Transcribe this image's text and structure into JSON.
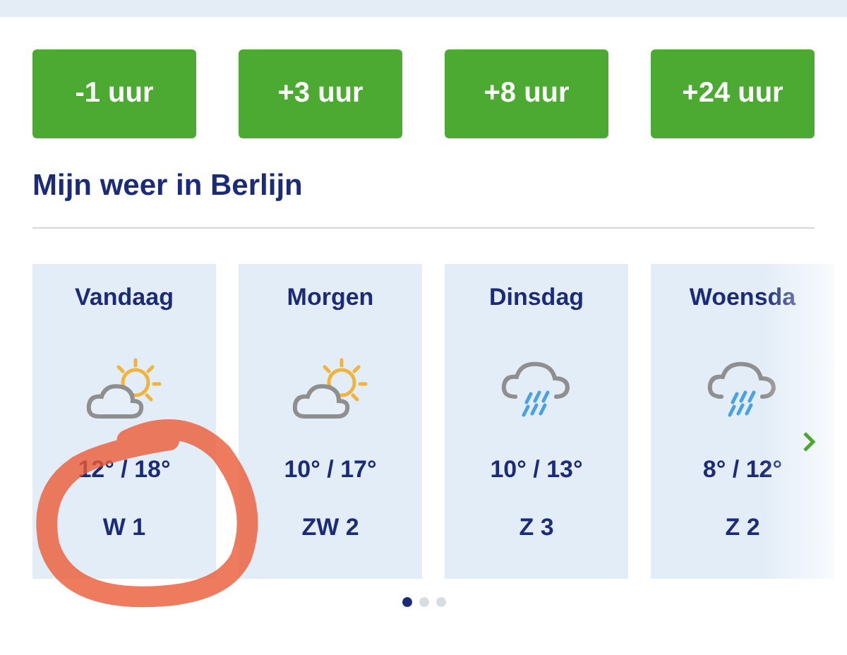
{
  "time_buttons": [
    "-1 uur",
    "+3 uur",
    "+8 uur",
    "+24 uur"
  ],
  "title": "Mijn weer in Berlijn",
  "days": [
    {
      "day": "Vandaag",
      "kind": "sun-cloud",
      "temps": "12° / 18°",
      "wind": "W 1"
    },
    {
      "day": "Morgen",
      "kind": "sun-cloud",
      "temps": "10° / 17°",
      "wind": "ZW 2"
    },
    {
      "day": "Dinsdag",
      "kind": "rain",
      "temps": "10° / 13°",
      "wind": "Z 3"
    },
    {
      "day": "Woensda",
      "kind": "rain",
      "temps": "8° / 12°",
      "wind": "Z 2"
    }
  ],
  "pages": [
    {
      "selected": true
    },
    {
      "selected": false
    },
    {
      "selected": false
    }
  ]
}
